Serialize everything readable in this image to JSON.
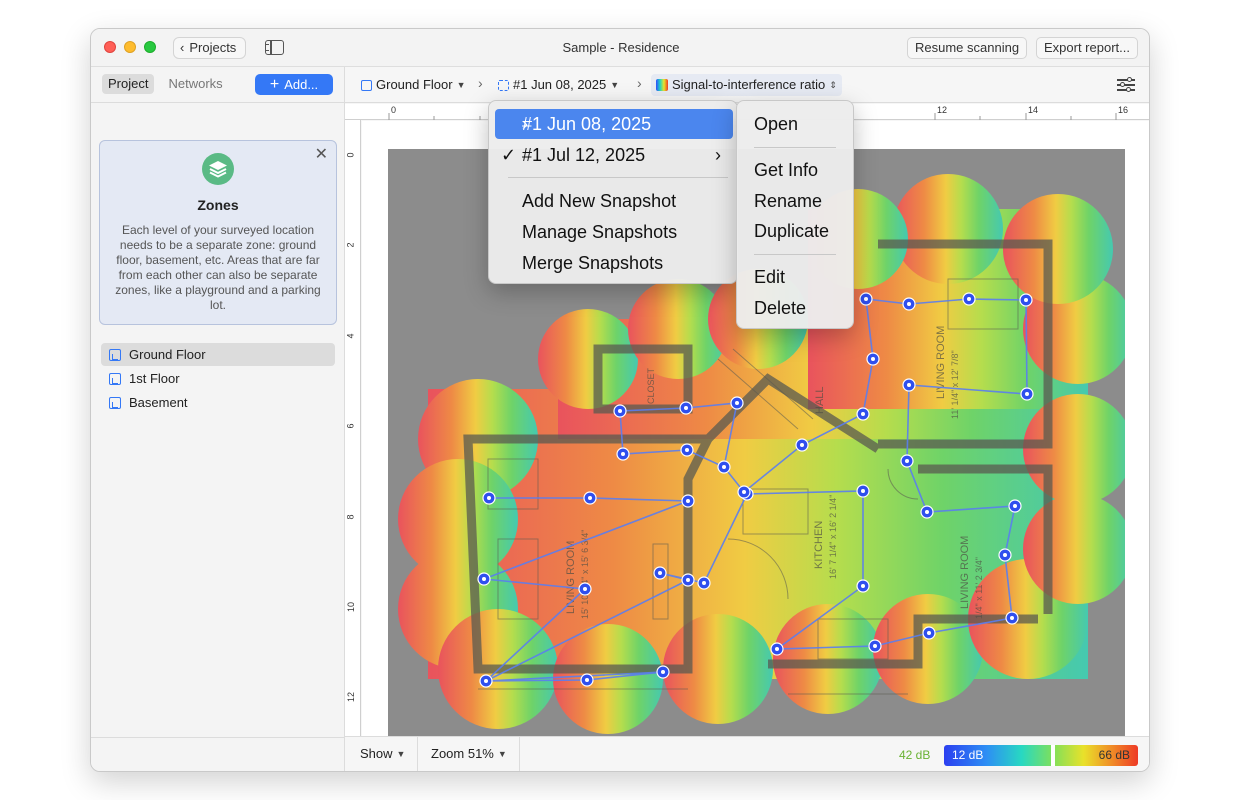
{
  "window": {
    "title": "Sample - Residence",
    "projects_label": "Projects",
    "resume_label": "Resume scanning",
    "export_label": "Export report..."
  },
  "sidebar": {
    "tabs": [
      "Project",
      "Networks"
    ],
    "add_label": "Add...",
    "zones_card": {
      "title": "Zones",
      "text": "Each level of your surveyed location needs to be a separate zone: ground floor, basement, etc. Areas that are far from each other can also be separate zones, like a playground and a parking lot."
    },
    "floors": [
      {
        "label": "Ground Floor",
        "selected": true
      },
      {
        "label": "1st Floor",
        "selected": false
      },
      {
        "label": "Basement",
        "selected": false
      }
    ]
  },
  "breadcrumb": {
    "floor": "Ground Floor",
    "snapshot": "#1 Jun 08, 2025",
    "metric": "Signal-to-interference ratio"
  },
  "rulers": {
    "top_ticks": [
      "0",
      "12",
      "14",
      "16"
    ],
    "left_ticks": [
      "0",
      "2",
      "4",
      "6",
      "8",
      "10",
      "12"
    ]
  },
  "plan_labels": {
    "rooms": [
      "LIVING ROOM",
      "KITCHEN",
      "HALL",
      "LIVING ROOM",
      "LIVING ROOM",
      "CLOSET"
    ],
    "dims": [
      "15' 10 3/4\" x 15' 6 3/4\"",
      "16' 7 1/4\" x 16' 2 1/4\"",
      "11' 1/4\" x 12' 7/8\"",
      "1/4\" x 11' 2 3/4\""
    ]
  },
  "snapshot_menu": {
    "items": [
      {
        "label": "#1 Jun 08, 2025",
        "highlighted": true,
        "checked": false,
        "submenu": true
      },
      {
        "label": "#1 Jul 12, 2025",
        "highlighted": false,
        "checked": true,
        "submenu": true
      }
    ],
    "actions": [
      "Add New Snapshot",
      "Manage Snapshots",
      "Merge Snapshots"
    ]
  },
  "context_menu": {
    "group1": [
      "Open"
    ],
    "group2": [
      "Get Info",
      "Rename",
      "Duplicate"
    ],
    "group3": [
      "Edit",
      "Delete"
    ]
  },
  "bottombar": {
    "show_label": "Show",
    "zoom_label": "Zoom 51%",
    "current_db": "42 dB",
    "legend_low": "12 dB",
    "legend_high": "66 dB"
  },
  "colors": {
    "accent": "#3478f6",
    "highlight": "#4b86ee",
    "point_blue": "#2f4fee",
    "current_db": "#6ab233"
  },
  "icons": {
    "zones": "layers-icon",
    "floor": "floor-plan-icon",
    "settings": "sliders-icon"
  }
}
